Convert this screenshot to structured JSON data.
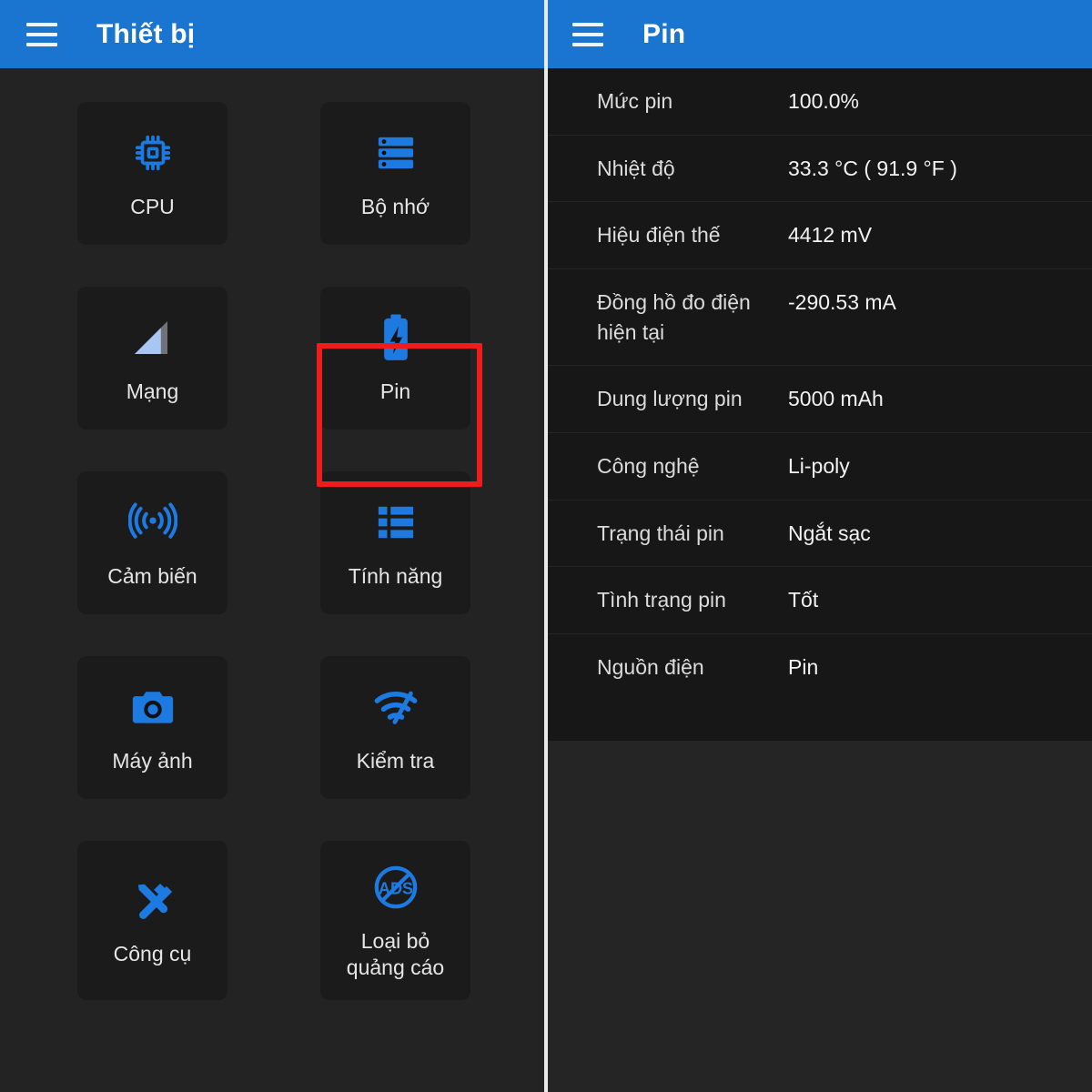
{
  "theme": {
    "appbar_blue": "#1a75d1",
    "icon_blue": "#1d7ae0",
    "highlight_red": "#f01c1c",
    "tile_bg": "#1b1b1b",
    "page_bg": "#232323",
    "card_bg": "#171717"
  },
  "left_panel": {
    "appbar": {
      "menu_icon": "hamburger-menu-icon",
      "title": "Thiết bị"
    },
    "tiles": [
      {
        "label": "CPU",
        "icon": "cpu-chip-icon"
      },
      {
        "label": "Bộ nhớ",
        "icon": "memory-storage-icon"
      },
      {
        "label": "Mạng",
        "icon": "signal-bars-icon"
      },
      {
        "label": "Pin",
        "icon": "battery-charging-icon",
        "highlighted": true
      },
      {
        "label": "Cảm biến",
        "icon": "sensor-waves-icon"
      },
      {
        "label": "Tính năng",
        "icon": "feature-list-icon"
      },
      {
        "label": "Máy ảnh",
        "icon": "camera-icon"
      },
      {
        "label": "Kiểm tra",
        "icon": "network-speed-test-icon"
      },
      {
        "label": "Công cụ",
        "icon": "tools-hammer-screwdriver-icon"
      },
      {
        "label": "Loại bỏ\nquảng cáo",
        "icon": "no-ads-icon"
      }
    ]
  },
  "right_panel": {
    "appbar": {
      "menu_icon": "hamburger-menu-icon",
      "title": "Pin"
    },
    "info_rows": [
      {
        "key": "Mức pin",
        "value": "100.0%"
      },
      {
        "key": "Nhiệt độ",
        "value": "33.3 °C  ( 91.9 °F )"
      },
      {
        "key": "Hiệu điện thế",
        "value": "4412 mV"
      },
      {
        "key": "Đồng hồ đo điện hiện tại",
        "value": "-290.53 mA"
      },
      {
        "key": "Dung lượng pin",
        "value": "5000 mAh"
      },
      {
        "key": "Công nghệ",
        "value": "Li-poly"
      },
      {
        "key": "Trạng thái pin",
        "value": "Ngắt sạc"
      },
      {
        "key": "Tình trạng pin",
        "value": "Tốt"
      },
      {
        "key": "Nguồn điện",
        "value": "Pin"
      }
    ]
  }
}
